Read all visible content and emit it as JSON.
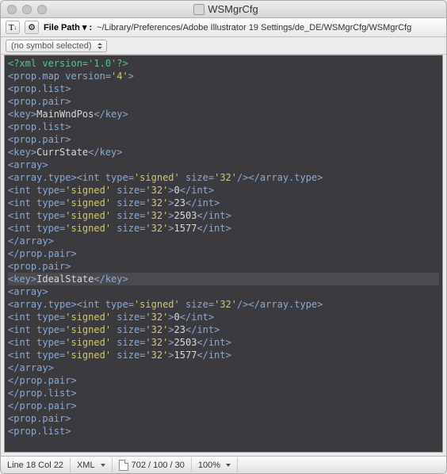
{
  "window": {
    "title": "WSMgrCfg"
  },
  "toolbar": {
    "text_btn": "T",
    "gear_btn": "⚙",
    "file_path_label": "File Path ▾ :",
    "file_path": "~/Library/Preferences/Adobe Illustrator 19 Settings/de_DE/WSMgrCfg/WSMgrCfg"
  },
  "symbol_selector": "(no symbol selected)",
  "code_lines": [
    {
      "hl": false,
      "seg": [
        {
          "c": "t-decl",
          "t": "<?xml version='1.0'?>"
        }
      ]
    },
    {
      "hl": false,
      "seg": [
        {
          "c": "t-tag",
          "t": "<prop.map "
        },
        {
          "c": "t-attr",
          "t": "version="
        },
        {
          "c": "t-str",
          "t": "'4'"
        },
        {
          "c": "t-tag",
          "t": ">"
        }
      ]
    },
    {
      "hl": false,
      "seg": [
        {
          "c": "t-tag",
          "t": "<prop.list>"
        }
      ]
    },
    {
      "hl": false,
      "seg": [
        {
          "c": "t-tag",
          "t": "<prop.pair>"
        }
      ]
    },
    {
      "hl": false,
      "seg": [
        {
          "c": "t-tag",
          "t": "<key>"
        },
        {
          "c": "t-text",
          "t": "MainWndPos"
        },
        {
          "c": "t-tag",
          "t": "</key>"
        }
      ]
    },
    {
      "hl": false,
      "seg": [
        {
          "c": "t-tag",
          "t": "<prop.list>"
        }
      ]
    },
    {
      "hl": false,
      "seg": [
        {
          "c": "t-tag",
          "t": "<prop.pair>"
        }
      ]
    },
    {
      "hl": false,
      "seg": [
        {
          "c": "t-tag",
          "t": "<key>"
        },
        {
          "c": "t-text",
          "t": "CurrState"
        },
        {
          "c": "t-tag",
          "t": "</key>"
        }
      ]
    },
    {
      "hl": false,
      "seg": [
        {
          "c": "t-tag",
          "t": "<array>"
        }
      ]
    },
    {
      "hl": false,
      "seg": [
        {
          "c": "t-tag",
          "t": "<array.type><int "
        },
        {
          "c": "t-attr",
          "t": "type="
        },
        {
          "c": "t-str",
          "t": "'signed'"
        },
        {
          "c": "t-tag",
          "t": " "
        },
        {
          "c": "t-attr",
          "t": "size="
        },
        {
          "c": "t-str",
          "t": "'32'"
        },
        {
          "c": "t-tag",
          "t": "/></array.type>"
        }
      ]
    },
    {
      "hl": false,
      "seg": [
        {
          "c": "t-tag",
          "t": "<int "
        },
        {
          "c": "t-attr",
          "t": "type="
        },
        {
          "c": "t-str",
          "t": "'signed'"
        },
        {
          "c": "t-tag",
          "t": " "
        },
        {
          "c": "t-attr",
          "t": "size="
        },
        {
          "c": "t-str",
          "t": "'32'"
        },
        {
          "c": "t-tag",
          "t": ">"
        },
        {
          "c": "t-text",
          "t": "0"
        },
        {
          "c": "t-tag",
          "t": "</int>"
        }
      ]
    },
    {
      "hl": false,
      "seg": [
        {
          "c": "t-tag",
          "t": "<int "
        },
        {
          "c": "t-attr",
          "t": "type="
        },
        {
          "c": "t-str",
          "t": "'signed'"
        },
        {
          "c": "t-tag",
          "t": " "
        },
        {
          "c": "t-attr",
          "t": "size="
        },
        {
          "c": "t-str",
          "t": "'32'"
        },
        {
          "c": "t-tag",
          "t": ">"
        },
        {
          "c": "t-text",
          "t": "23"
        },
        {
          "c": "t-tag",
          "t": "</int>"
        }
      ]
    },
    {
      "hl": false,
      "seg": [
        {
          "c": "t-tag",
          "t": "<int "
        },
        {
          "c": "t-attr",
          "t": "type="
        },
        {
          "c": "t-str",
          "t": "'signed'"
        },
        {
          "c": "t-tag",
          "t": " "
        },
        {
          "c": "t-attr",
          "t": "size="
        },
        {
          "c": "t-str",
          "t": "'32'"
        },
        {
          "c": "t-tag",
          "t": ">"
        },
        {
          "c": "t-text",
          "t": "2503"
        },
        {
          "c": "t-tag",
          "t": "</int>"
        }
      ]
    },
    {
      "hl": false,
      "seg": [
        {
          "c": "t-tag",
          "t": "<int "
        },
        {
          "c": "t-attr",
          "t": "type="
        },
        {
          "c": "t-str",
          "t": "'signed'"
        },
        {
          "c": "t-tag",
          "t": " "
        },
        {
          "c": "t-attr",
          "t": "size="
        },
        {
          "c": "t-str",
          "t": "'32'"
        },
        {
          "c": "t-tag",
          "t": ">"
        },
        {
          "c": "t-text",
          "t": "1577"
        },
        {
          "c": "t-tag",
          "t": "</int>"
        }
      ]
    },
    {
      "hl": false,
      "seg": [
        {
          "c": "t-tag",
          "t": "</array>"
        }
      ]
    },
    {
      "hl": false,
      "seg": [
        {
          "c": "t-tag",
          "t": "</prop.pair>"
        }
      ]
    },
    {
      "hl": false,
      "seg": [
        {
          "c": "t-tag",
          "t": "<prop.pair>"
        }
      ]
    },
    {
      "hl": true,
      "seg": [
        {
          "c": "t-tag",
          "t": "<key>"
        },
        {
          "c": "t-text",
          "t": "IdealState"
        },
        {
          "c": "t-tag",
          "t": "</key>"
        }
      ]
    },
    {
      "hl": false,
      "seg": [
        {
          "c": "t-tag",
          "t": "<array>"
        }
      ]
    },
    {
      "hl": false,
      "seg": [
        {
          "c": "t-tag",
          "t": "<array.type><int "
        },
        {
          "c": "t-attr",
          "t": "type="
        },
        {
          "c": "t-str",
          "t": "'signed'"
        },
        {
          "c": "t-tag",
          "t": " "
        },
        {
          "c": "t-attr",
          "t": "size="
        },
        {
          "c": "t-str",
          "t": "'32'"
        },
        {
          "c": "t-tag",
          "t": "/></array.type>"
        }
      ]
    },
    {
      "hl": false,
      "seg": [
        {
          "c": "t-tag",
          "t": "<int "
        },
        {
          "c": "t-attr",
          "t": "type="
        },
        {
          "c": "t-str",
          "t": "'signed'"
        },
        {
          "c": "t-tag",
          "t": " "
        },
        {
          "c": "t-attr",
          "t": "size="
        },
        {
          "c": "t-str",
          "t": "'32'"
        },
        {
          "c": "t-tag",
          "t": ">"
        },
        {
          "c": "t-text",
          "t": "0"
        },
        {
          "c": "t-tag",
          "t": "</int>"
        }
      ]
    },
    {
      "hl": false,
      "seg": [
        {
          "c": "t-tag",
          "t": "<int "
        },
        {
          "c": "t-attr",
          "t": "type="
        },
        {
          "c": "t-str",
          "t": "'signed'"
        },
        {
          "c": "t-tag",
          "t": " "
        },
        {
          "c": "t-attr",
          "t": "size="
        },
        {
          "c": "t-str",
          "t": "'32'"
        },
        {
          "c": "t-tag",
          "t": ">"
        },
        {
          "c": "t-text",
          "t": "23"
        },
        {
          "c": "t-tag",
          "t": "</int>"
        }
      ]
    },
    {
      "hl": false,
      "seg": [
        {
          "c": "t-tag",
          "t": "<int "
        },
        {
          "c": "t-attr",
          "t": "type="
        },
        {
          "c": "t-str",
          "t": "'signed'"
        },
        {
          "c": "t-tag",
          "t": " "
        },
        {
          "c": "t-attr",
          "t": "size="
        },
        {
          "c": "t-str",
          "t": "'32'"
        },
        {
          "c": "t-tag",
          "t": ">"
        },
        {
          "c": "t-text",
          "t": "2503"
        },
        {
          "c": "t-tag",
          "t": "</int>"
        }
      ]
    },
    {
      "hl": false,
      "seg": [
        {
          "c": "t-tag",
          "t": "<int "
        },
        {
          "c": "t-attr",
          "t": "type="
        },
        {
          "c": "t-str",
          "t": "'signed'"
        },
        {
          "c": "t-tag",
          "t": " "
        },
        {
          "c": "t-attr",
          "t": "size="
        },
        {
          "c": "t-str",
          "t": "'32'"
        },
        {
          "c": "t-tag",
          "t": ">"
        },
        {
          "c": "t-text",
          "t": "1577"
        },
        {
          "c": "t-tag",
          "t": "</int>"
        }
      ]
    },
    {
      "hl": false,
      "seg": [
        {
          "c": "t-tag",
          "t": "</array>"
        }
      ]
    },
    {
      "hl": false,
      "seg": [
        {
          "c": "t-tag",
          "t": "</prop.pair>"
        }
      ]
    },
    {
      "hl": false,
      "seg": [
        {
          "c": "t-tag",
          "t": "</prop.list>"
        }
      ]
    },
    {
      "hl": false,
      "seg": [
        {
          "c": "t-tag",
          "t": "</prop.pair>"
        }
      ]
    },
    {
      "hl": false,
      "seg": [
        {
          "c": "t-tag",
          "t": "<prop.pair>"
        }
      ]
    },
    {
      "hl": false,
      "seg": [
        {
          "c": "t-tag",
          "t": "<prop.list>"
        }
      ]
    }
  ],
  "status": {
    "pos": "Line 18 Col 22",
    "lang": "XML",
    "counts": "702 / 100 / 30",
    "zoom": "100%"
  }
}
